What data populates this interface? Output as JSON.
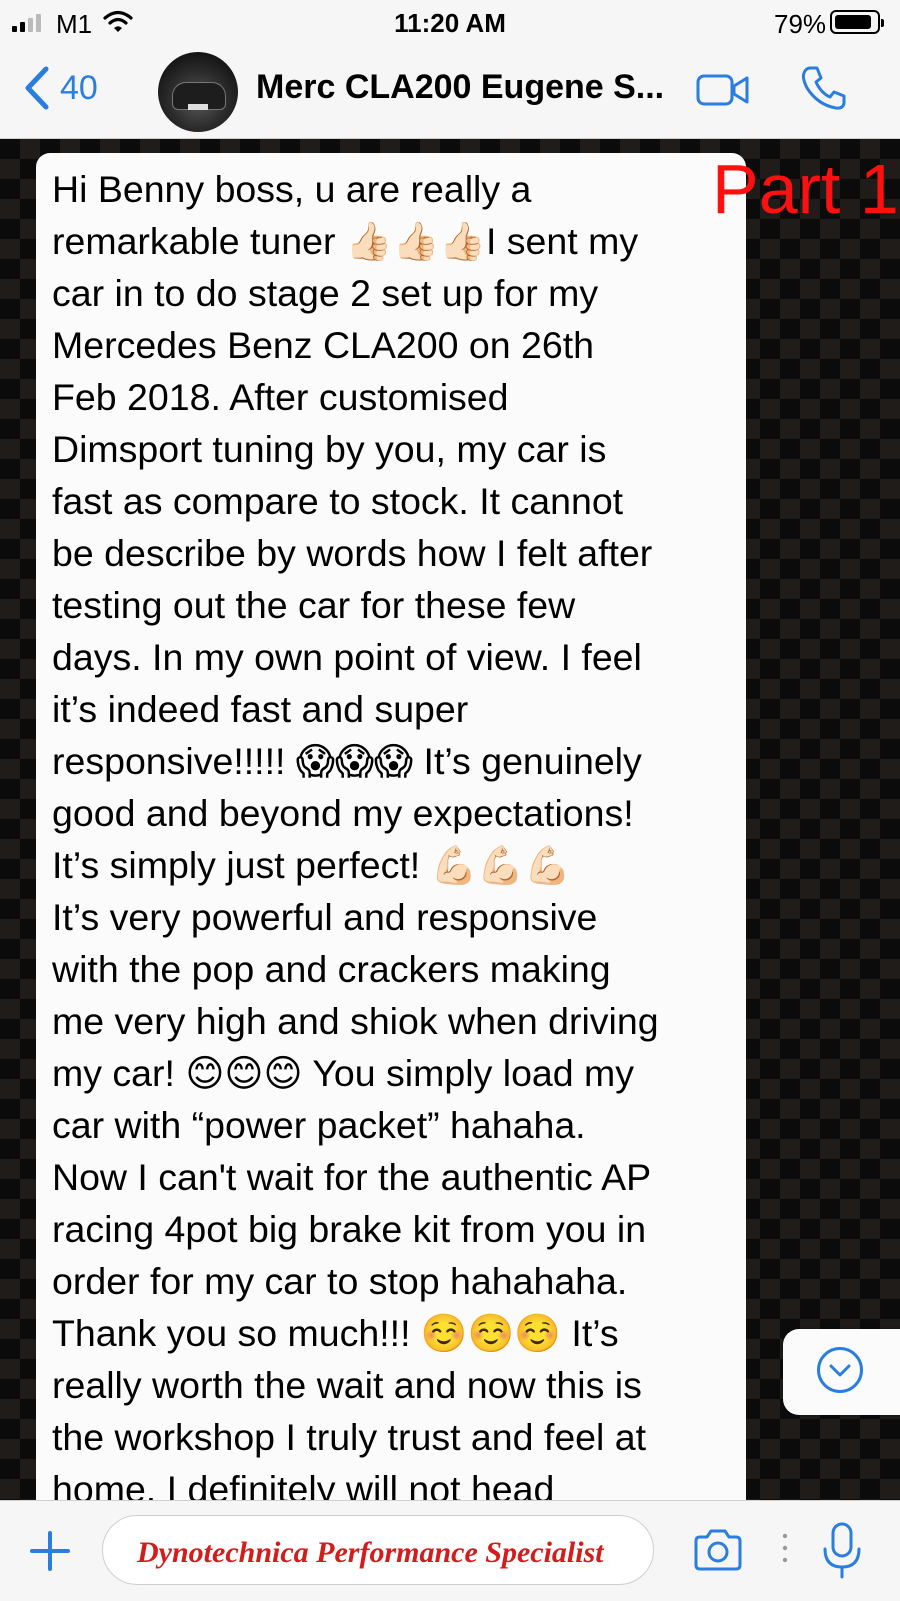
{
  "status_bar": {
    "carrier": "M1",
    "time": "11:20 AM",
    "battery_percent": "79%",
    "battery_level": 0.79
  },
  "header": {
    "back_count": "40",
    "title": "Merc CLA200 Eugene S...",
    "icons": [
      "chevron-left-icon",
      "video-call-icon",
      "phone-icon"
    ]
  },
  "chat": {
    "overlay_label": "Part 1",
    "message_text": "Hi Benny boss, u are really a\nremarkable tuner 👍🏻👍🏻👍🏻I sent my\ncar in to do stage 2 set up for my\nMercedes Benz CLA200 on 26th\nFeb 2018. After customised\nDimsport tuning by you, my car is\nfast as compare to stock. It cannot\nbe describe by words how I felt after\ntesting out the car for these few\ndays. In my own point of view. I feel\nit’s indeed fast and super\nresponsive!!!!! 😱😱😱 It’s genuinely\ngood and beyond my expectations!\nIt’s simply just perfect! 💪🏻💪🏻💪🏻\nIt’s very powerful and responsive\nwith the pop and crackers making\nme very high and shiok when driving\nmy car! 😊😊😊 You simply load my\ncar with “power packet” hahaha.\nNow I can't wait for the authentic AP\nracing 4pot big brake kit from you in\norder for my car to stop hahahaha.\nThank you so much!!! ☺️☺️☺️ It’s\nreally worth the wait and now this is\nthe workshop I truly trust and feel at\nhome. I definitely will not head",
    "scroll_icon": "chevron-down-circle-icon"
  },
  "input_bar": {
    "watermark_text": "Dynotechnica Performance Specialist",
    "icons": [
      "plus-icon",
      "camera-icon",
      "microphone-icon"
    ]
  },
  "colors": {
    "accent": "#2a7ee0",
    "part_label": "#ff1010",
    "watermark": "#d51b1b"
  }
}
